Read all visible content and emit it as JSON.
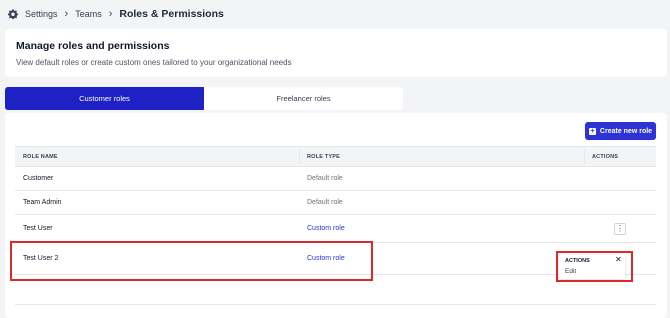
{
  "breadcrumb": {
    "icon": "gear-icon",
    "items": [
      "Settings",
      "Teams",
      "Roles & Permissions"
    ]
  },
  "header": {
    "title": "Manage roles and permissions",
    "subtitle": "View default roles or create custom ones tailored to your organizational needs"
  },
  "tabs": [
    {
      "label": "Customer roles",
      "active": true
    },
    {
      "label": "Freelancer roles",
      "active": false
    }
  ],
  "create_button": {
    "label": "Create new role",
    "icon": "plus-square-icon"
  },
  "table": {
    "columns": [
      "ROLE NAME",
      "ROLE TYPE",
      "ACTIONS"
    ],
    "rows": [
      {
        "name": "Customer",
        "type": "Default role"
      },
      {
        "name": "Team Admin",
        "type": "Default role"
      },
      {
        "name": "Test User",
        "type": "Custom role"
      },
      {
        "name": "Test User 2",
        "type": "Custom role"
      }
    ]
  },
  "actions_popup": {
    "title": "ACTIONS",
    "items": [
      "Edit"
    ]
  },
  "colors": {
    "accent": "#1e22c4",
    "button": "#2d33d6",
    "highlight": "#d92b2b"
  }
}
